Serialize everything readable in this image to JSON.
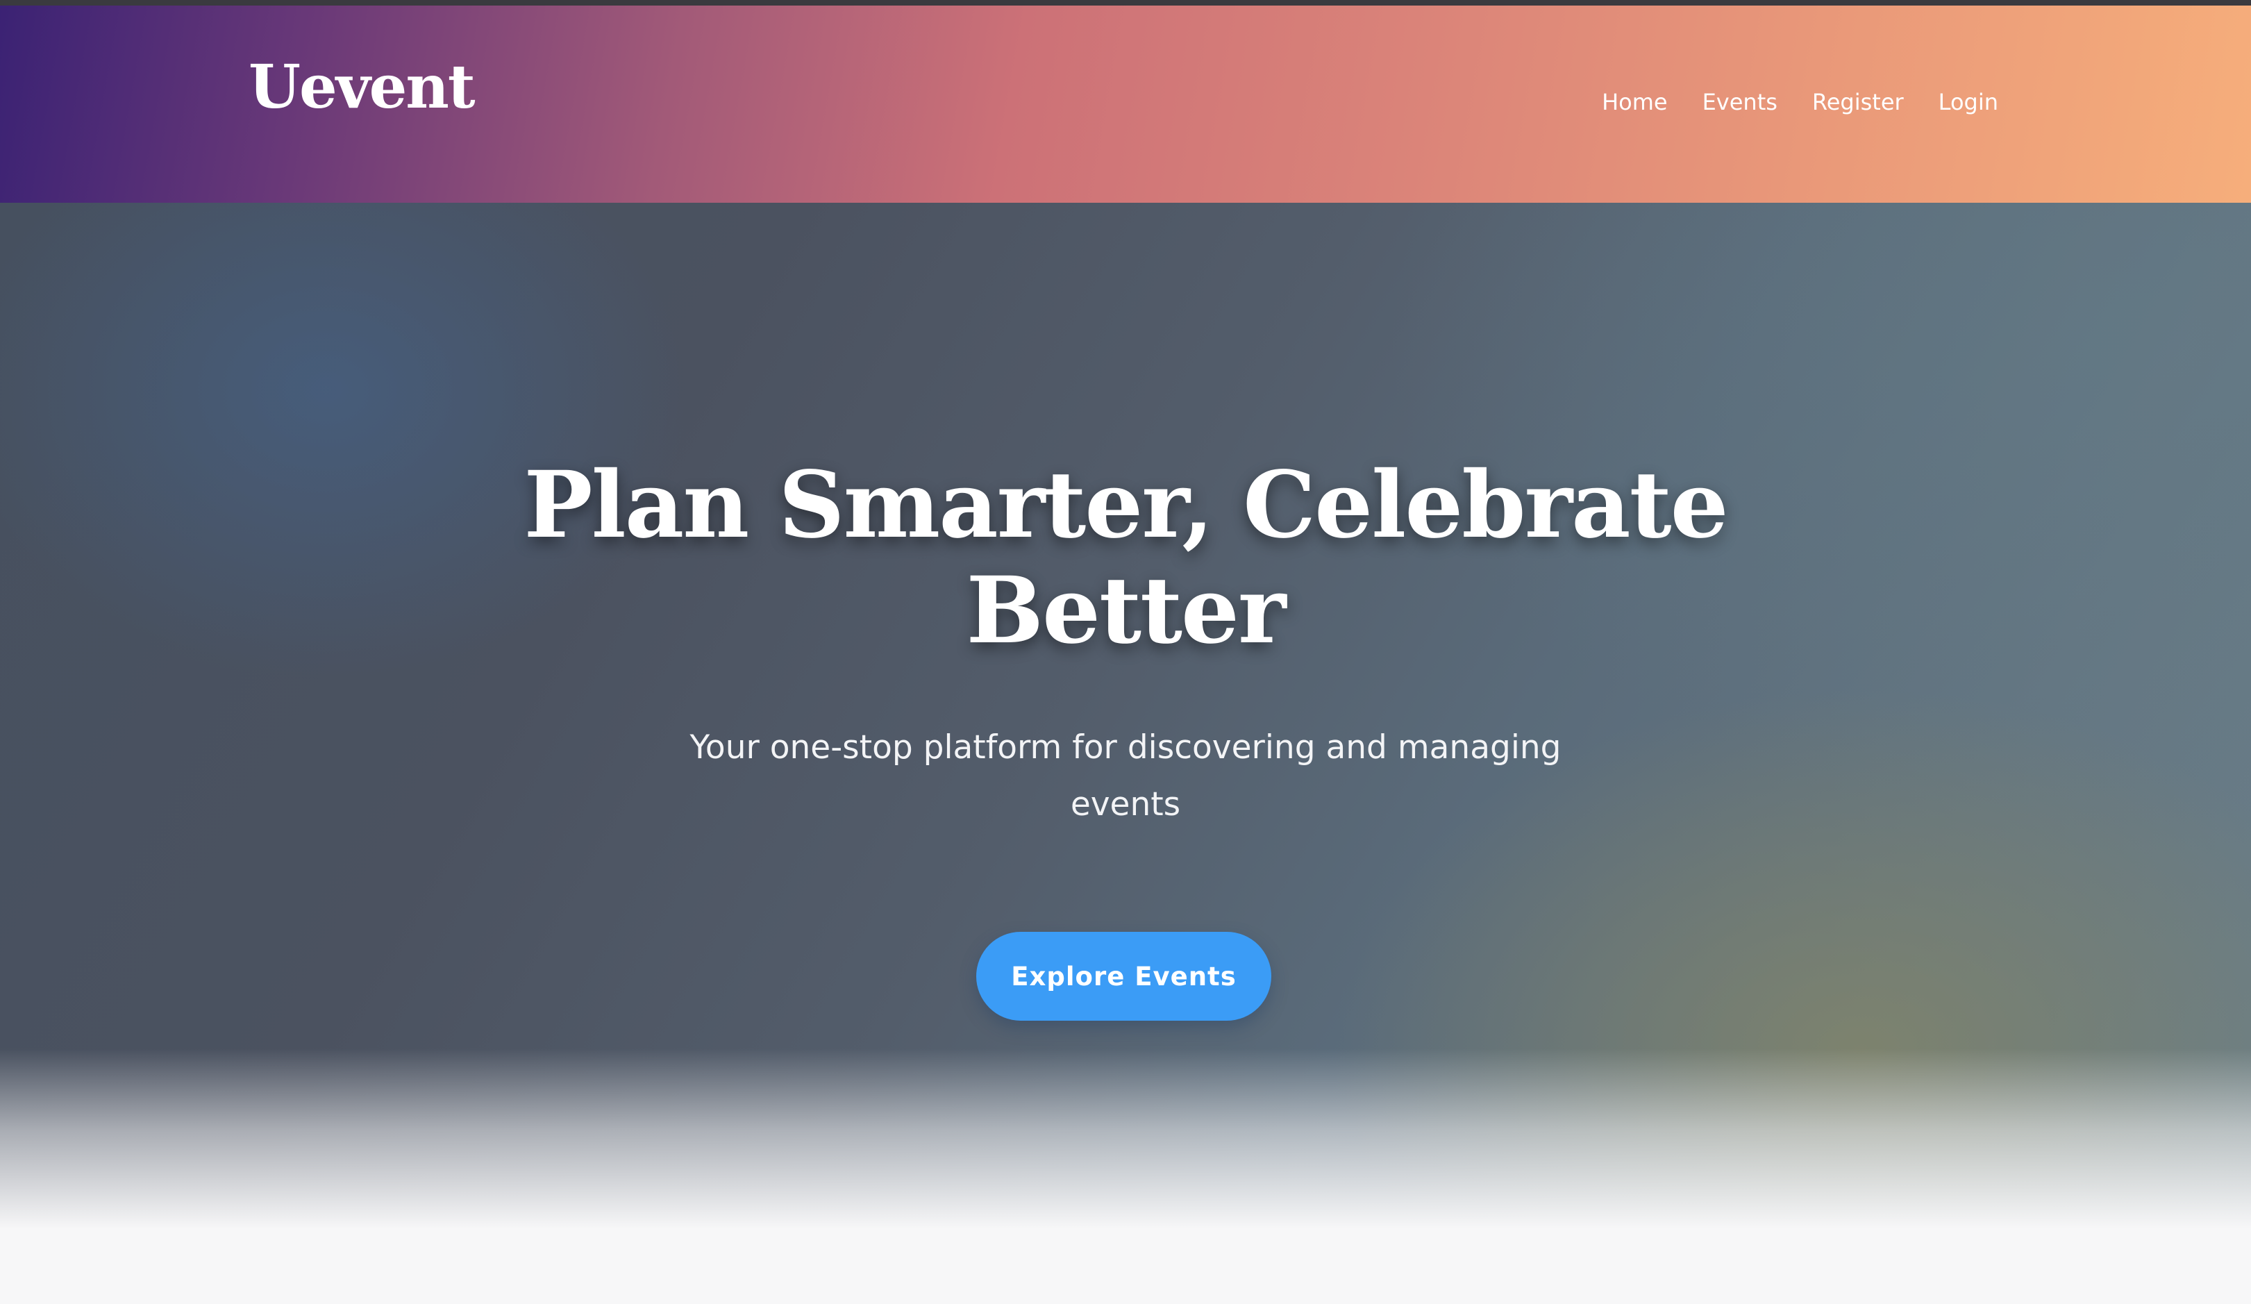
{
  "header": {
    "brand": "Uevent",
    "nav": [
      {
        "label": "Home"
      },
      {
        "label": "Events"
      },
      {
        "label": "Register"
      },
      {
        "label": "Login"
      }
    ]
  },
  "hero": {
    "title_line1": "Plan Smarter, Celebrate",
    "title_line2": "Better",
    "subtitle": "Your one-stop platform for discovering and managing events",
    "cta_label": "Explore Events"
  },
  "colors": {
    "header_gradient_start": "#3b2274",
    "header_gradient_mid": "#cc7177",
    "header_gradient_end": "#f6ae7b",
    "cta_background": "#3b9cf6",
    "page_background": "#f7f7f8"
  }
}
